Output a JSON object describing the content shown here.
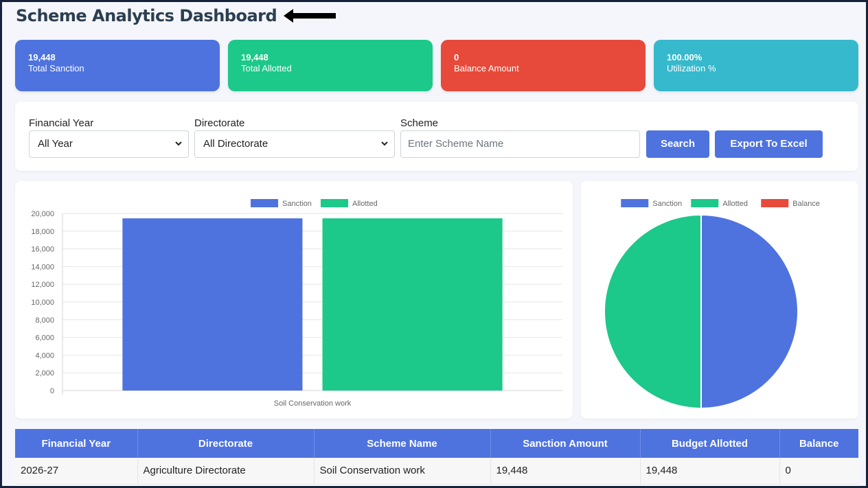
{
  "header": {
    "title": "Scheme Analytics Dashboard"
  },
  "cards": [
    {
      "value": "19,448",
      "label": "Total Sanction",
      "color": "#4e73df"
    },
    {
      "value": "19,448",
      "label": "Total Allotted",
      "color": "#1cc88a"
    },
    {
      "value": "0",
      "label": "Balance Amount",
      "color": "#e74a3b"
    },
    {
      "value": "100.00%",
      "label": "Utilization %",
      "color": "#36b9cc"
    }
  ],
  "filters": {
    "financial_year": {
      "label": "Financial Year",
      "selected": "All Year"
    },
    "directorate": {
      "label": "Directorate",
      "selected": "All Directorate"
    },
    "scheme": {
      "label": "Scheme",
      "placeholder": "Enter Scheme Name",
      "value": ""
    },
    "search_label": "Search",
    "export_label": "Export To Excel"
  },
  "chart_data": [
    {
      "type": "bar",
      "categories": [
        "Soil Conservation work"
      ],
      "series": [
        {
          "name": "Sanction",
          "values": [
            19448
          ],
          "color": "#4e73df"
        },
        {
          "name": "Allotted",
          "values": [
            19448
          ],
          "color": "#1cc88a"
        }
      ],
      "ylim": [
        0,
        20000
      ],
      "yticks": [
        "20,000",
        "18,000",
        "16,000",
        "14,000",
        "12,000",
        "10,000",
        "8,000",
        "6,000",
        "4,000",
        "2,000",
        "0"
      ],
      "legend": "top",
      "grid": true
    },
    {
      "type": "pie",
      "labels": [
        "Sanction",
        "Allotted",
        "Balance"
      ],
      "values": [
        19448,
        19448,
        0
      ],
      "colors": [
        "#4e73df",
        "#1cc88a",
        "#e74a3b"
      ],
      "legend": "top"
    }
  ],
  "table": {
    "headers": [
      "Financial Year",
      "Directorate",
      "Scheme Name",
      "Sanction Amount",
      "Budget Allotted",
      "Balance"
    ],
    "rows": [
      [
        "2026-27",
        "Agriculture Directorate",
        "Soil Conservation work",
        "19,448",
        "19,448",
        "0"
      ]
    ]
  }
}
